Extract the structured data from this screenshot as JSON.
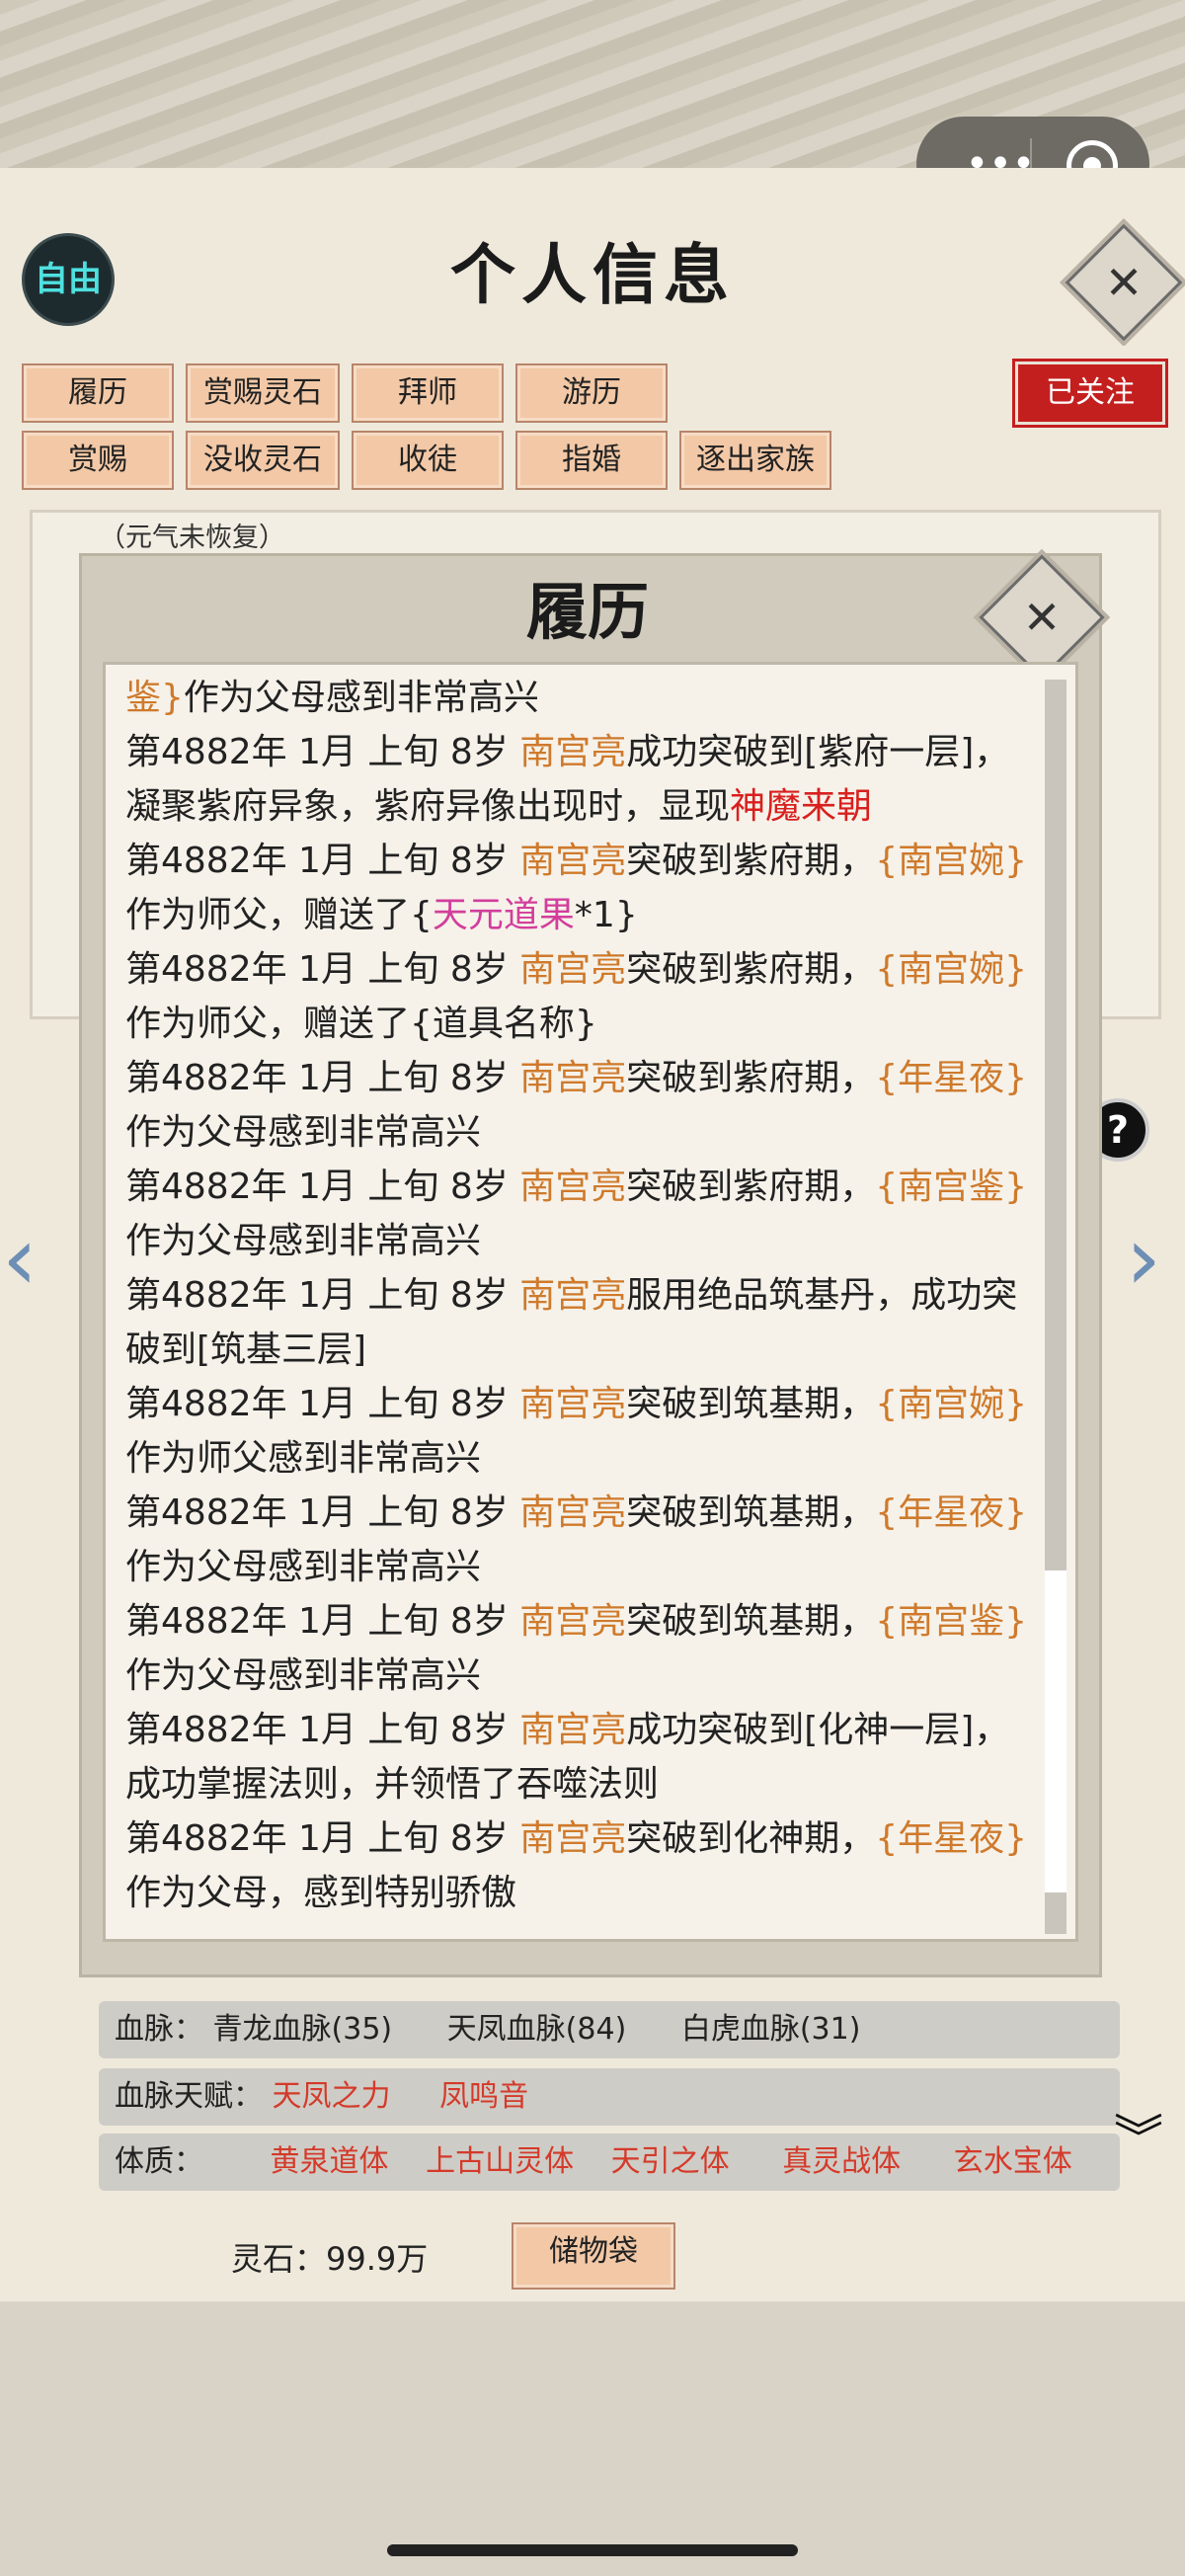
{
  "header": {
    "free_badge": "自由",
    "title": "个人信息",
    "close_symbol": "✕"
  },
  "capsule": {
    "more": "•••"
  },
  "buttons_row1": [
    "履历",
    "赏赐灵石",
    "拜师",
    "游历"
  ],
  "buttons_row2": [
    "赏赐",
    "没收灵石",
    "收徒",
    "指婚",
    "逐出家族"
  ],
  "followed_label": "已关注",
  "info": {
    "qi_status": "（元气未恢复）"
  },
  "lower": {
    "bloodline_label": "血脉：",
    "bloodlines": [
      "青龙血脉(35)",
      "天凤血脉(84)",
      "白虎血脉(31)"
    ],
    "bloodline_talent_label": "血脉天赋：",
    "bloodline_talents": [
      "天凤之力",
      "凤鸣音"
    ],
    "physique_label": "体质：",
    "physiques": [
      "黄泉道体",
      "上古山灵体",
      "天引之体",
      "真灵战体",
      "玄水宝体"
    ],
    "spirit_stone": "灵石：99.9万",
    "bag_button": "储物袋",
    "help": "?",
    "expand_icon": "︾"
  },
  "modal": {
    "title": "履历",
    "close_symbol": "✕",
    "entries": [
      [
        {
          "t": "鉴}",
          "c": "o"
        },
        {
          "t": "作为父母感到非常高兴"
        }
      ],
      [
        {
          "t": "第4882年 1月 上旬  8岁  "
        },
        {
          "t": "南宫亮",
          "c": "o"
        },
        {
          "t": "成功突破到[紫府一层]，凝聚紫府异象，紫府异像出现时，显现"
        },
        {
          "t": "神魔来朝",
          "c": "rd"
        }
      ],
      [
        {
          "t": "第4882年 1月 上旬  8岁  "
        },
        {
          "t": "南宫亮",
          "c": "o"
        },
        {
          "t": "突破到紫府期，"
        },
        {
          "t": "{南宫婉}",
          "c": "o"
        },
        {
          "t": "作为师父，赠送了{"
        },
        {
          "t": "天元道果",
          "c": "pk"
        },
        {
          "t": "*1}"
        }
      ],
      [
        {
          "t": "第4882年 1月 上旬  8岁  "
        },
        {
          "t": "南宫亮",
          "c": "o"
        },
        {
          "t": "突破到紫府期，"
        },
        {
          "t": "{南宫婉}",
          "c": "o"
        },
        {
          "t": "作为师父，赠送了{道具名称}"
        }
      ],
      [
        {
          "t": "第4882年 1月 上旬  8岁  "
        },
        {
          "t": "南宫亮",
          "c": "o"
        },
        {
          "t": "突破到紫府期，"
        },
        {
          "t": "{年星夜}",
          "c": "o"
        },
        {
          "t": "作为父母感到非常高兴"
        }
      ],
      [
        {
          "t": "第4882年 1月 上旬  8岁  "
        },
        {
          "t": "南宫亮",
          "c": "o"
        },
        {
          "t": "突破到紫府期，"
        },
        {
          "t": "{南宫鉴}",
          "c": "o"
        },
        {
          "t": "作为父母感到非常高兴"
        }
      ],
      [
        {
          "t": "第4882年 1月 上旬 8岁 "
        },
        {
          "t": "南宫亮",
          "c": "o"
        },
        {
          "t": "服用绝品筑基丹，成功突破到[筑基三层]"
        }
      ],
      [
        {
          "t": "第4882年 1月 上旬  8岁  "
        },
        {
          "t": "南宫亮",
          "c": "o"
        },
        {
          "t": "突破到筑基期，"
        },
        {
          "t": "{南宫婉}",
          "c": "o"
        },
        {
          "t": "作为师父感到非常高兴"
        }
      ],
      [
        {
          "t": "第4882年 1月 上旬  8岁  "
        },
        {
          "t": "南宫亮",
          "c": "o"
        },
        {
          "t": "突破到筑基期，"
        },
        {
          "t": "{年星夜}",
          "c": "o"
        },
        {
          "t": "作为父母感到非常高兴"
        }
      ],
      [
        {
          "t": "第4882年 1月 上旬  8岁  "
        },
        {
          "t": "南宫亮",
          "c": "o"
        },
        {
          "t": "突破到筑基期，"
        },
        {
          "t": "{南宫鉴}",
          "c": "o"
        },
        {
          "t": "作为父母感到非常高兴"
        }
      ],
      [
        {
          "t": "第4882年 1月 上旬  8岁  "
        },
        {
          "t": "南宫亮",
          "c": "o"
        },
        {
          "t": "成功突破到[化神一层]，成功掌握法则，并领悟了吞噬法则"
        }
      ],
      [
        {
          "t": "第4882年 1月 上旬  8岁  "
        },
        {
          "t": "南宫亮",
          "c": "o"
        },
        {
          "t": "突破到化神期，"
        },
        {
          "t": "{年星夜}",
          "c": "o"
        },
        {
          "t": "作为父母，感到特别骄傲"
        }
      ]
    ]
  },
  "colors": {
    "accent_orange": "#cf7a2c",
    "red": "#d8201e",
    "pink": "#d23e9b",
    "button_fill": "#f2c8a6",
    "follow_red": "#c41f1f"
  }
}
